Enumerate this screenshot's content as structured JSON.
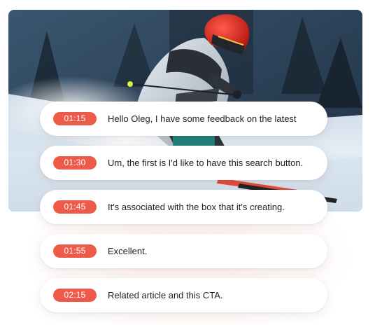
{
  "colors": {
    "accent": "#ee5a4a",
    "card_background": "#ffffff",
    "text": "#1f1f1f"
  },
  "photo": {
    "subject": "skier-in-red-helmet-on-snowy-slope"
  },
  "captions": [
    {
      "time": "01:15",
      "text": "Hello Oleg, I have some feedback on the latest"
    },
    {
      "time": "01:30",
      "text": "Um, the first is I'd like to have this search button."
    },
    {
      "time": "01:45",
      "text": "It's associated with the box that it's creating."
    },
    {
      "time": "01:55",
      "text": "Excellent."
    },
    {
      "time": "02:15",
      "text": "Related article and this CTA."
    }
  ]
}
